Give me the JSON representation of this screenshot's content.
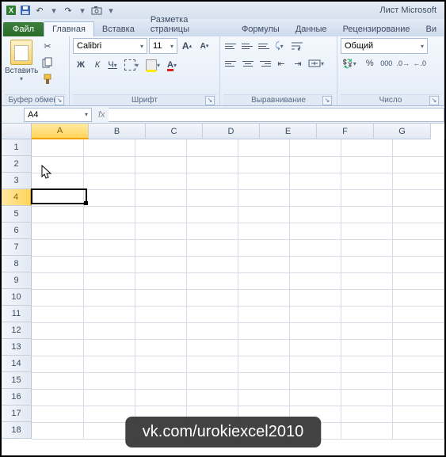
{
  "title": "Лист Microsoft",
  "tabs": {
    "file": "Файл",
    "items": [
      "Главная",
      "Вставка",
      "Разметка страницы",
      "Формулы",
      "Данные",
      "Рецензирование",
      "Ви"
    ],
    "active": 0
  },
  "ribbon": {
    "clipboard": {
      "paste": "Вставить",
      "label": "Буфер обмена"
    },
    "font": {
      "name": "Calibri",
      "size": "11",
      "bold": "Ж",
      "italic": "К",
      "underline": "Ч",
      "grow": "A",
      "shrink": "A",
      "label": "Шрифт"
    },
    "alignment": {
      "label": "Выравнивание"
    },
    "number": {
      "format": "Общий",
      "label": "Число"
    }
  },
  "namebox": "A4",
  "fx": "fx",
  "columns": [
    "A",
    "B",
    "C",
    "D",
    "E",
    "F",
    "G"
  ],
  "rows": [
    "1",
    "2",
    "3",
    "4",
    "5",
    "6",
    "7",
    "8",
    "9",
    "10",
    "11",
    "12",
    "13",
    "14",
    "15",
    "16",
    "17",
    "18"
  ],
  "selected": {
    "col": 0,
    "row": 3
  },
  "watermark": "vk.com/urokiexcel2010"
}
